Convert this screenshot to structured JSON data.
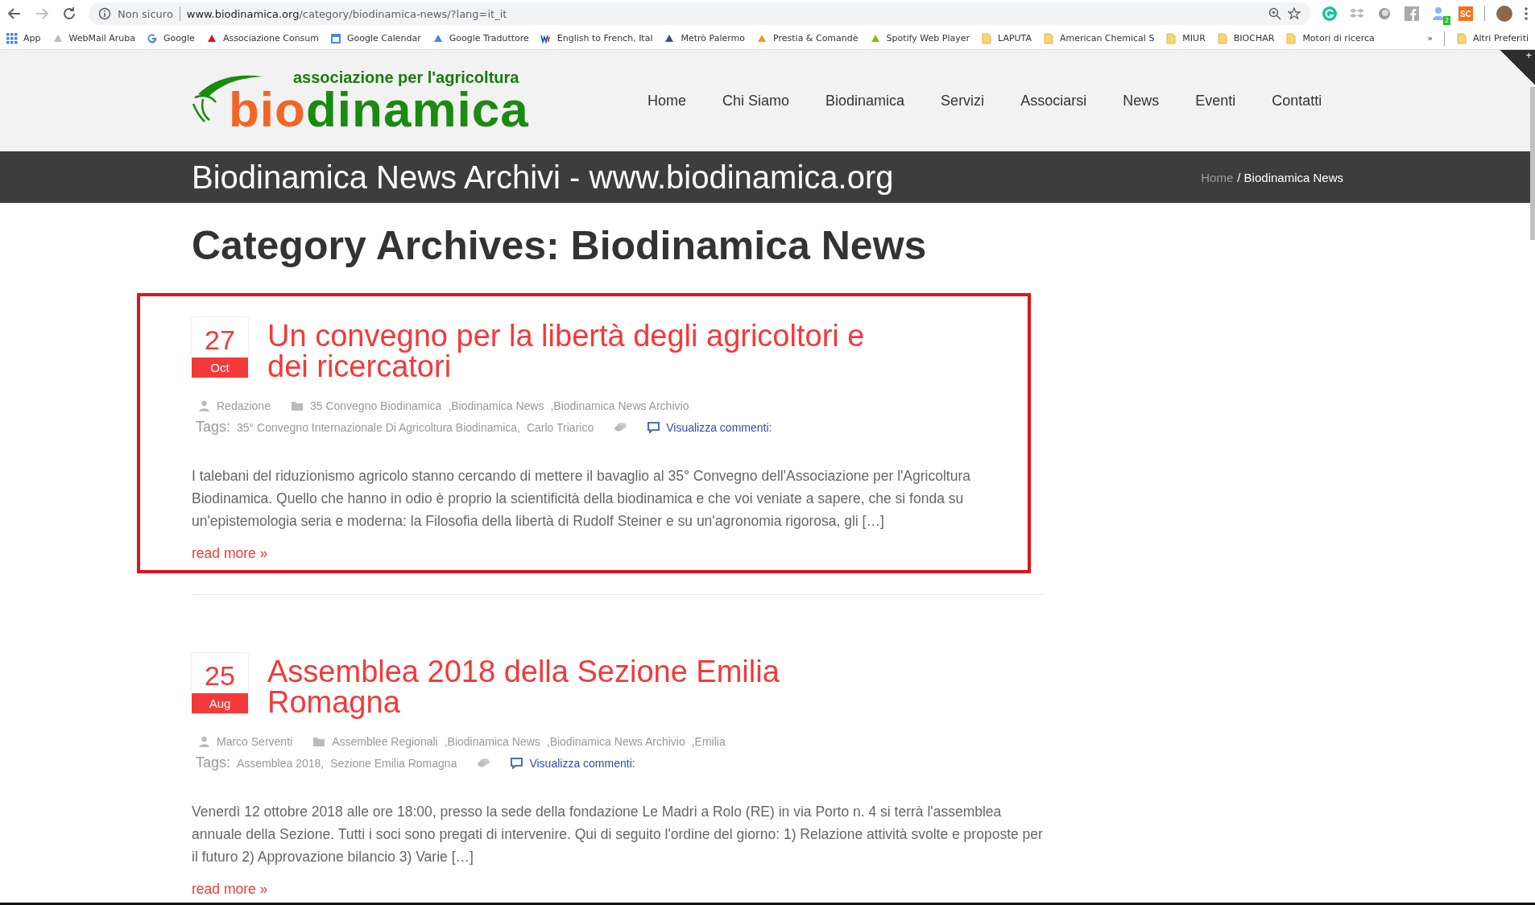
{
  "browser": {
    "security_label": "Non sicuro",
    "url_host": "www.biodinamica.org",
    "url_path": "/category/biodinamica-news/?lang=it_it",
    "extension_badge": "2",
    "extension_sc": "SC"
  },
  "bookmarks": [
    {
      "label": "App",
      "kind": "apps",
      "color": "#4285f4"
    },
    {
      "label": "WebMail Aruba",
      "kind": "site",
      "color": "#bbbbbb"
    },
    {
      "label": "Google",
      "kind": "google",
      "color": "#4285f4"
    },
    {
      "label": "Associazione Consum",
      "kind": "site",
      "color": "#e0101a"
    },
    {
      "label": "Google Calendar",
      "kind": "calendar",
      "color": "#4285f4"
    },
    {
      "label": "Google Traduttore",
      "kind": "site",
      "color": "#4285f4"
    },
    {
      "label": "English to French, Ital",
      "kind": "wr",
      "color": "#1d4bb8"
    },
    {
      "label": "Metrò Palermo",
      "kind": "site",
      "color": "#3a4a9a"
    },
    {
      "label": "Prestia & Comandè",
      "kind": "site",
      "color": "#e0a020"
    },
    {
      "label": "Spotify Web Player",
      "kind": "site",
      "color": "#84bd00"
    },
    {
      "label": "LAPUTA",
      "kind": "folder",
      "color": "#f7d774"
    },
    {
      "label": "American Chemical S",
      "kind": "folder",
      "color": "#f7d774"
    },
    {
      "label": "MIUR",
      "kind": "folder",
      "color": "#f7d774"
    },
    {
      "label": "BIOCHAR",
      "kind": "folder",
      "color": "#f7d774"
    },
    {
      "label": "Motori di ricerca",
      "kind": "folder",
      "color": "#f7d774"
    }
  ],
  "bookmarks_more": "»",
  "other_bookmarks": "Altri Preferiti",
  "logo": {
    "tagline": "associazione per l'agricoltura",
    "word_start": "bio",
    "word_end": "dinamica"
  },
  "nav": [
    {
      "label": "Home"
    },
    {
      "label": "Chi Siamo"
    },
    {
      "label": "Biodinamica"
    },
    {
      "label": "Servizi"
    },
    {
      "label": "Associarsi"
    },
    {
      "label": "News"
    },
    {
      "label": "Eventi"
    },
    {
      "label": "Contatti"
    }
  ],
  "corner_toggle": "+",
  "title_bar": {
    "title": "Biodinamica News Archivi - www.biodinamica.org",
    "breadcrumb_home": "Home",
    "breadcrumb_current": "/ Biodinamica News"
  },
  "heading": "Category Archives: Biodinamica News",
  "posts": [
    {
      "highlighted": true,
      "day": "27",
      "month": "Oct",
      "title": "Un convegno per la libertà degli agricoltori e dei ricercatori",
      "author": "Redazione",
      "categories": [
        "35 Convegno Biodinamica",
        ",Biodinamica News",
        ",Biodinamica News Archivio"
      ],
      "tags_label": "Tags:",
      "tags": [
        "35° Convegno Internazionale Di Agricoltura Biodinamica,",
        "Carlo Triarico"
      ],
      "comments": "Visualizza commenti:",
      "excerpt": "I talebani del riduzionismo agricolo stanno cercando di mettere il bavaglio al 35° Convegno dell'Associazione per l'Agricoltura Biodinamica. Quello che hanno in odio è proprio la scientificità della biodinamica e che voi veniate a sapere, che si fonda su un'epistemologia seria e moderna: la Filosofia della libertà di Rudolf Steiner e su un'agronomia rigorosa, gli […]",
      "read_more": "read more »"
    },
    {
      "highlighted": false,
      "day": "25",
      "month": "Aug",
      "title": "Assemblea 2018 della Sezione Emilia Romagna",
      "author": "Marco Serventi",
      "categories": [
        "Assemblee Regionali",
        ",Biodinamica News",
        ",Biodinamica News Archivio",
        ",Emilia"
      ],
      "tags_label": "Tags:",
      "tags": [
        "Assemblea 2018,",
        "Sezione Emilia Romagna"
      ],
      "comments": "Visualizza commenti:",
      "excerpt": "Venerdì 12 ottobre 2018 alle ore 18:00, presso la sede della fondazione Le Madri a Rolo (RE) in via Porto n. 4 si terrà l'assemblea annuale della Sezione. Tutti i soci sono pregati di intervenire. Qui di seguito l'ordine del giorno: 1) Relazione attività svolte e proposte per il futuro 2) Approvazione bilancio 3) Varie […]",
      "read_more": "read more »"
    }
  ]
}
